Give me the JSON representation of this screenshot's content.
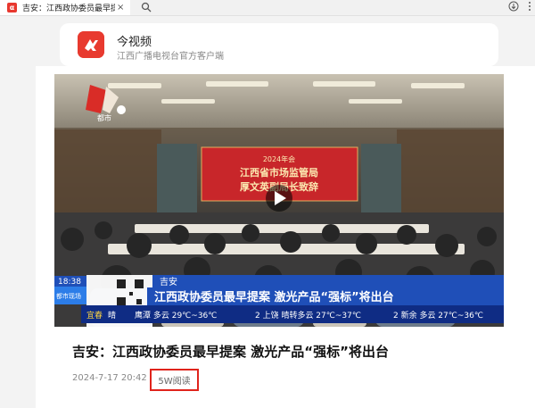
{
  "browser": {
    "tab_title": "吉安：江西政协委员最早提案",
    "tab_close": "×",
    "logo_letter": "α"
  },
  "app": {
    "name": "今视频",
    "subtitle": "江西广播电视台官方客户端"
  },
  "video": {
    "screen_year": "2024年会",
    "screen_line1": "江西省市场监管局",
    "screen_line2": "厚文英副局长致辞",
    "time": "18:38",
    "location": "吉安",
    "headline": "江西政协委员最早提案  激光产品“强标”将出台",
    "station_badge": "都市",
    "qr_label": "都市现场",
    "weather": [
      {
        "city": "宜春",
        "text": "晴"
      },
      {
        "city": "",
        "text": "鹰潭 多云 29℃~36℃"
      },
      {
        "city": "",
        "text": "2 上饶 晴转多云 27℃~37℃"
      },
      {
        "city": "",
        "text": "2 新余 多云 27℃~36℃"
      }
    ]
  },
  "article": {
    "title": "吉安：江西政协委员最早提案 激光产品“强标”将出台",
    "date": "2024-7-17 20:42",
    "reads": "5W阅读"
  },
  "colors": {
    "brand_red": "#e83a2f",
    "highlight_red": "#e0241c",
    "ticker_blue": "#1f4fb8"
  }
}
